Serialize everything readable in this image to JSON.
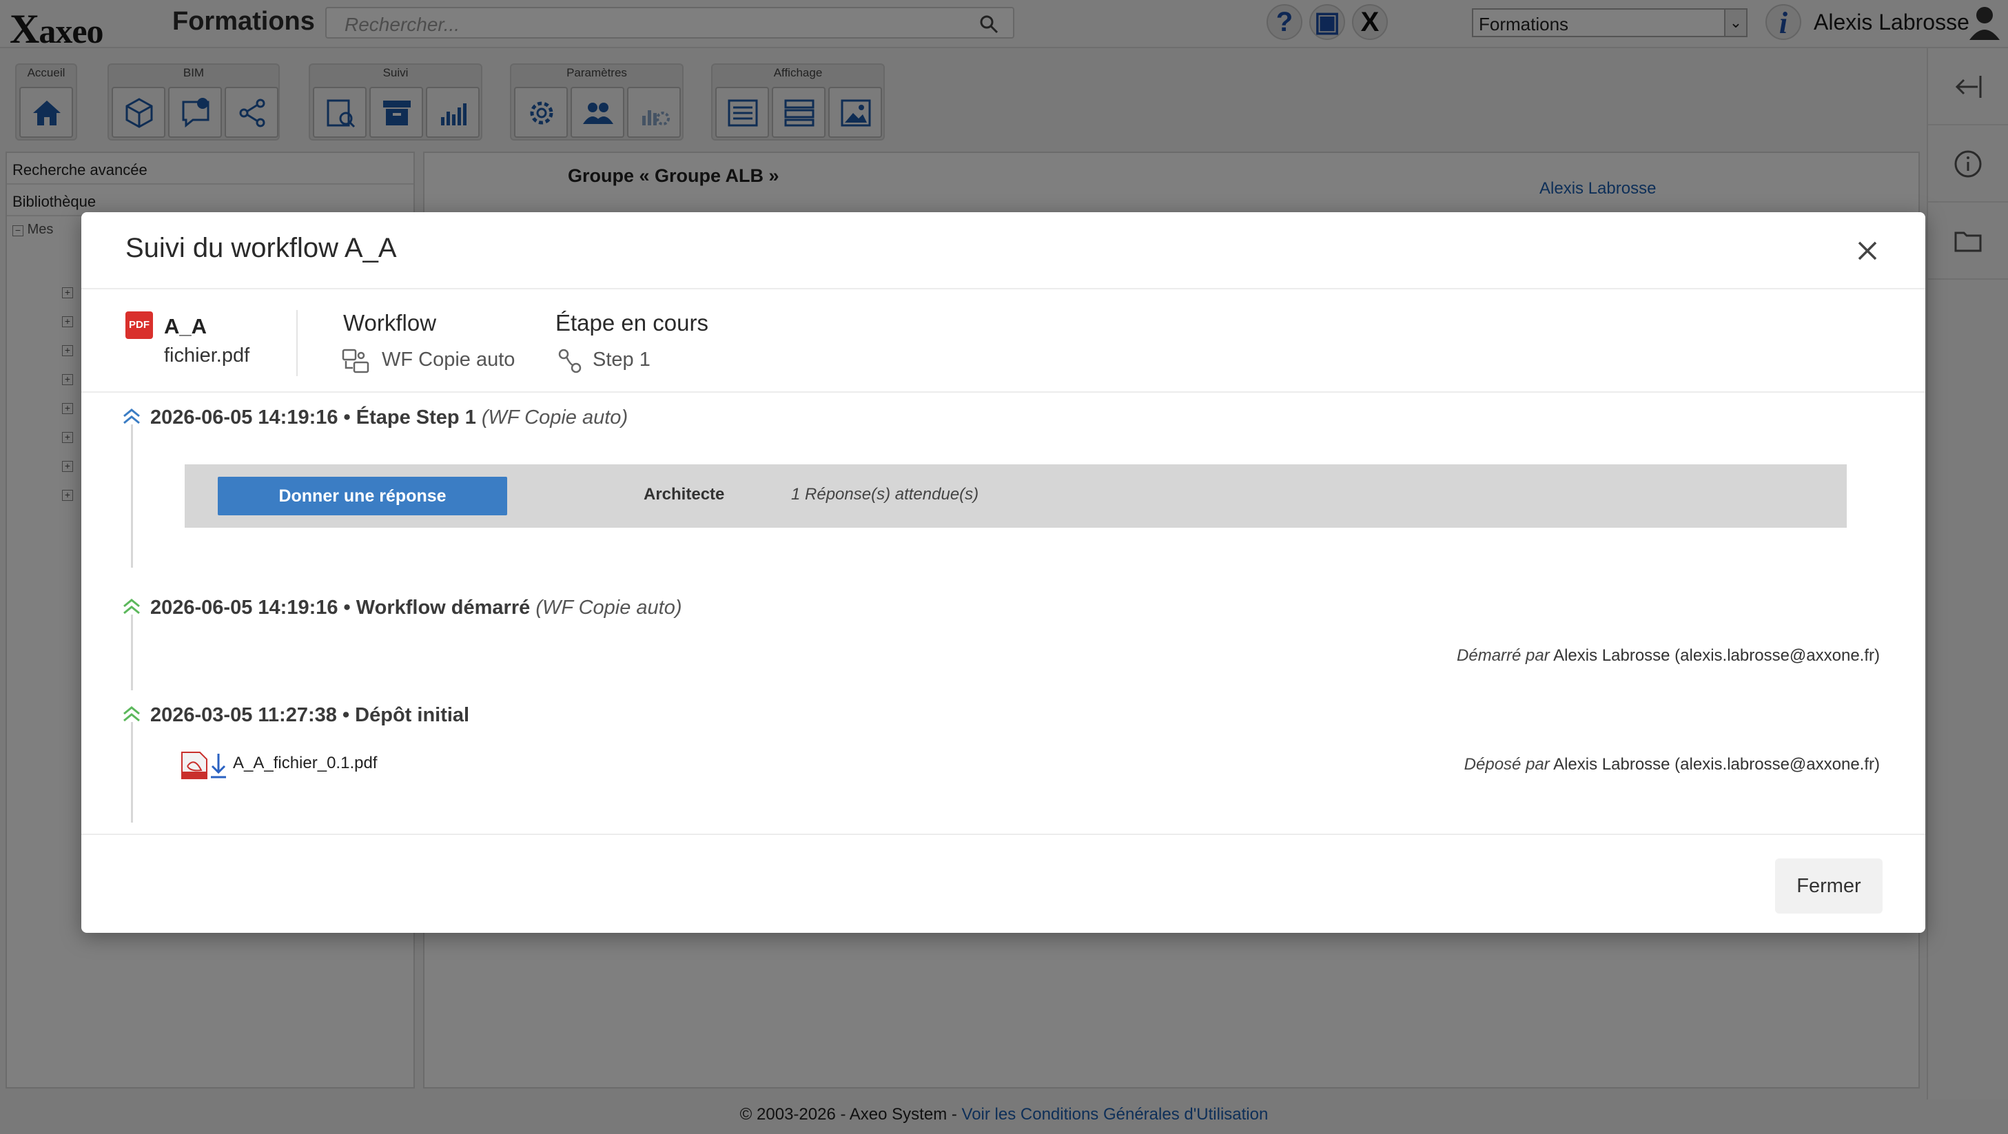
{
  "app": {
    "title": "Formations",
    "search_placeholder": "Rechercher...",
    "project_select": "Formations",
    "user_name": "Alexis Labrosse"
  },
  "toolbar": {
    "groups": [
      {
        "label": "Accueil"
      },
      {
        "label": "BIM"
      },
      {
        "label": "Suivi"
      },
      {
        "label": "Paramètres"
      },
      {
        "label": "Affichage"
      }
    ]
  },
  "sidebar": {
    "advanced_search": "Recherche avancée",
    "library": "Bibliothèque",
    "tree_root": "Mes"
  },
  "main": {
    "group_title": "Groupe « Groupe ALB »",
    "user_link": "Alexis Labrosse"
  },
  "modal": {
    "title": "Suivi du workflow A_A",
    "document": {
      "badge": "PDF",
      "name": "A_A",
      "file": "fichier.pdf"
    },
    "workflow_label": "Workflow",
    "workflow_value": "WF Copie auto",
    "step_label": "Étape en cours",
    "step_value": "Step 1",
    "events": [
      {
        "timestamp": "2026-06-05 14:19:16",
        "separator": " • ",
        "title": "Étape Step 1",
        "context": "(WF Copie auto)",
        "color": "#3b7dc4"
      },
      {
        "timestamp": "2026-06-05 14:19:16",
        "separator": " • ",
        "title": "Workflow démarré",
        "context": "(WF Copie auto)",
        "by_label": "Démarré par",
        "by_value": "Alexis Labrosse (alexis.labrosse@axxone.fr)",
        "color": "#5cb85c"
      },
      {
        "timestamp": "2026-03-05 11:27:38",
        "separator": " • ",
        "title": "Dépôt initial",
        "by_label": "Déposé par",
        "by_value": "Alexis Labrosse (alexis.labrosse@axxone.fr)",
        "file_name": "A_A_fichier_0.1.pdf",
        "color": "#5cb85c"
      }
    ],
    "response": {
      "button": "Donner une réponse",
      "role": "Architecte",
      "expected": "1 Réponse(s) attendue(s)"
    },
    "close_button": "Fermer"
  },
  "footer": {
    "copyright": "© 2003-2026 - Axeo System  - ",
    "link": "Voir les Conditions Générales d'Utilisation"
  }
}
